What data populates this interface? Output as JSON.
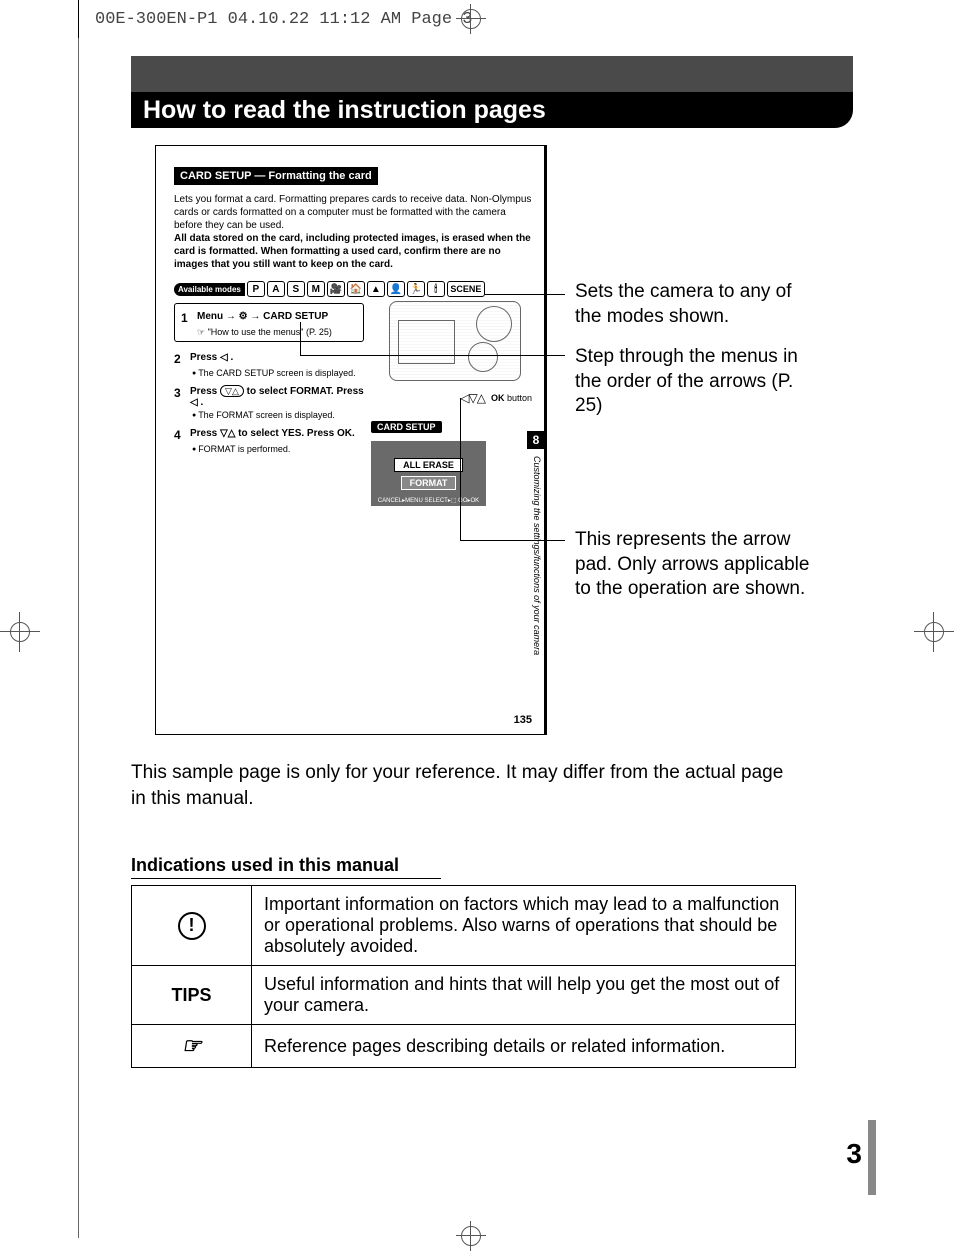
{
  "printer_marks": "00E-300EN-P1  04.10.22 11:12 AM  Page 3",
  "title": "How to read the instruction pages",
  "sample": {
    "header": "CARD SETUP — Formatting the card",
    "intro_plain": "Lets you format a card. Formatting prepares cards to receive data. Non-Olympus cards or cards formatted on a computer must be formatted with the camera before they can be used.",
    "intro_bold": "All data stored on the card, including protected images, is erased when the card is formatted. When formatting a used card, confirm there are no images that you still want to keep on the card.",
    "modes_label": "Available modes",
    "modes": [
      "P",
      "A",
      "S",
      "M",
      "🎥",
      "🏠",
      "▲",
      "👤",
      "🏃",
      "🕯",
      "SCENE"
    ],
    "step1": "Menu → ⚙ → CARD SETUP",
    "step1_ref": "☞ \"How to use the menus\" (P. 25)",
    "step2": "Press ◁ .",
    "step2_sub": "The CARD SETUP screen is displayed.",
    "step3_a": "Press",
    "step3_b": "to select FORMAT. Press",
    "step3_c": "◁ .",
    "step3_sub": "The FORMAT screen is displayed.",
    "step4": "Press ▽△ to select YES. Press OK.",
    "step4_sub": "FORMAT is performed.",
    "arrow_pad_icons": "◁▽△",
    "ok_label": "OK button",
    "lcd_title": "CARD SETUP",
    "lcd_btn1": "ALL ERASE",
    "lcd_btn2": "FORMAT",
    "lcd_foot": "CANCEL▸MENU  SELECT▸⬚  GO▸OK",
    "thumb": "8",
    "side_text": "Customizing the settings/functions of your camera",
    "page_num": "135"
  },
  "callouts": {
    "c1": "Sets the camera to any of the modes shown.",
    "c2": "Step through the menus in the order of the arrows (P. 25)",
    "c3": "This represents the arrow pad. Only arrows applicable to the operation are shown."
  },
  "reference_note": "This sample page is only for your reference. It may differ from the actual page in this manual.",
  "indications_heading": "Indications used in this manual",
  "indications": {
    "row1_icon": "!",
    "row1_text": "Important information on factors which may lead to a malfunction or operational problems. Also warns of operations that should be absolutely avoided.",
    "row2_icon": "TIPS",
    "row2_text": "Useful information and hints that will help you get the most out of your camera.",
    "row3_icon": "☞",
    "row3_text": "Reference pages describing details or related information."
  },
  "page_number": "3"
}
